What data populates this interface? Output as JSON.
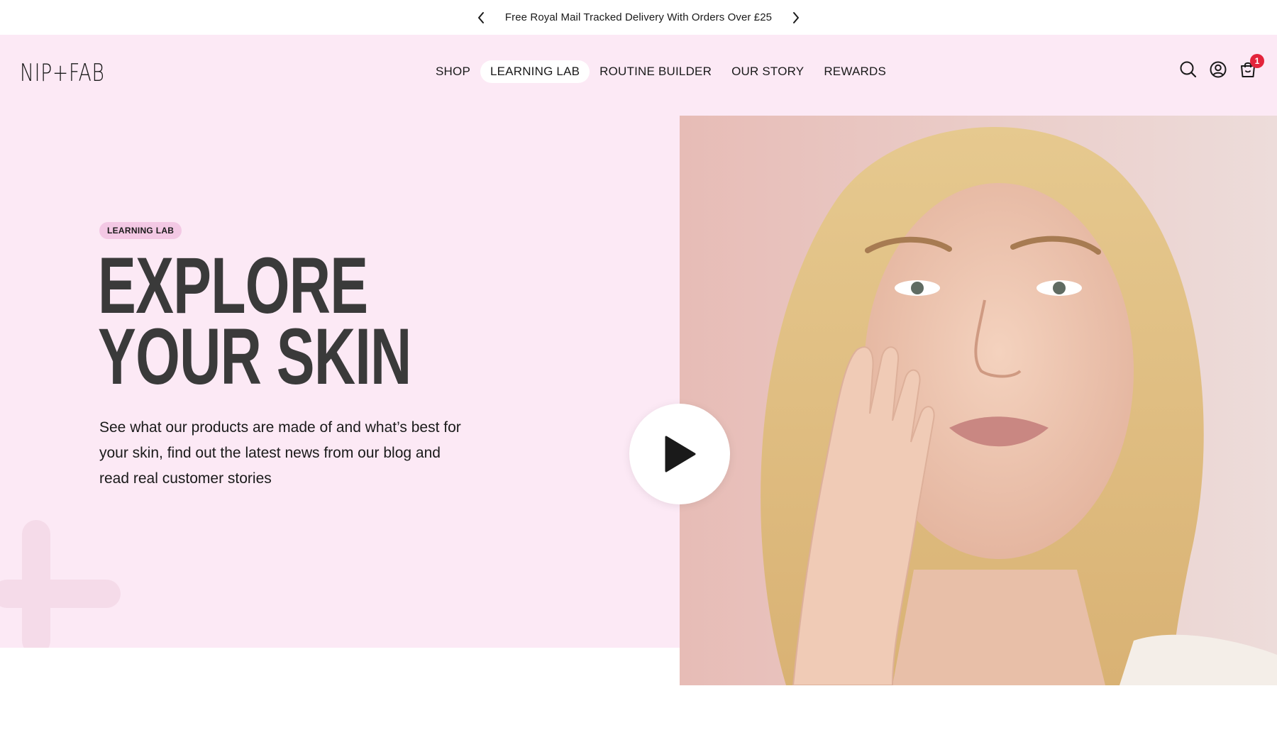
{
  "announcement": {
    "message": "Free Royal Mail Tracked Delivery With Orders Over £25",
    "prev_icon": "chevron-left-icon",
    "next_icon": "chevron-right-icon"
  },
  "header": {
    "logo": "NIP+FAB",
    "nav": [
      {
        "label": "SHOP",
        "active": false
      },
      {
        "label": "LEARNING LAB",
        "active": true
      },
      {
        "label": "ROUTINE BUILDER",
        "active": false
      },
      {
        "label": "OUR STORY",
        "active": false
      },
      {
        "label": "REWARDS",
        "active": false
      }
    ],
    "icons": [
      "search-icon",
      "account-icon",
      "cart-icon"
    ],
    "cart_count": "1"
  },
  "hero": {
    "tag": "LEARNING LAB",
    "headline_line1": "EXPLORE",
    "headline_line2": "YOUR SKIN",
    "description": "See what our products are made of and what’s best for your skin, find out the latest news from our blog and read real customer stories",
    "play_icon": "play-icon"
  },
  "colors": {
    "header_bg": "#fce9f5",
    "tag_bg": "#f3c8e4",
    "headline": "#3a3a3a",
    "badge": "#e3243b"
  }
}
